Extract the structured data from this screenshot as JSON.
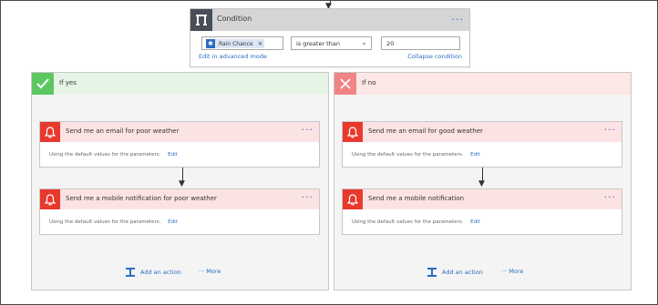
{
  "condition": {
    "title": "Condition",
    "token_label": "Rain Chance",
    "operator": "is greater than",
    "value": "20",
    "edit_advanced": "Edit in advanced mode",
    "collapse": "Collapse condition",
    "menu": "···"
  },
  "branches": {
    "yes": {
      "title": "If yes",
      "actions": [
        {
          "title": "Send me an email for poor weather",
          "body": "Using the default values for the parameters.",
          "edit": "Edit",
          "menu": "···"
        },
        {
          "title": "Send me a mobile notification for poor weather",
          "body": "Using the default values for the parameters.",
          "edit": "Edit",
          "menu": "···"
        }
      ],
      "add_action": "Add an action",
      "more": "··· More"
    },
    "no": {
      "title": "If no",
      "actions": [
        {
          "title": "Send me an email for good weather",
          "body": "Using the default values for the parameters.",
          "edit": "Edit",
          "menu": "···"
        },
        {
          "title": "Send me a mobile notification",
          "body": "Using the default values for the parameters.",
          "edit": "Edit",
          "menu": "···"
        }
      ],
      "add_action": "Add an action",
      "more": "··· More"
    }
  },
  "colors": {
    "accent": "#2b6cc4",
    "yes": "#5cc760",
    "no": "#f08585",
    "action_icon": "#e8392c"
  },
  "icons": {
    "condition": "condition-icon",
    "yes": "check-icon",
    "no": "x-icon",
    "action": "bell-icon",
    "add": "add-action-icon"
  }
}
